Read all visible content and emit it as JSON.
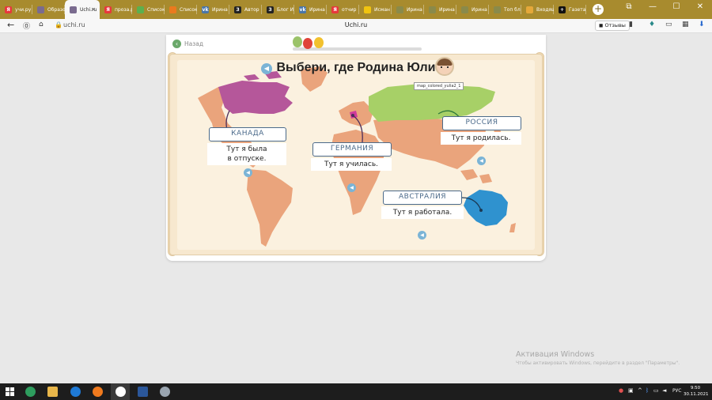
{
  "tabs": [
    {
      "label": "учи.ру",
      "color": "#e7373c",
      "glyph": "Я"
    },
    {
      "label": "Образо",
      "color": "#7a6b8f",
      "glyph": ""
    },
    {
      "label": "Uchi.ru",
      "color": "#7a6b8f",
      "glyph": "",
      "active": true,
      "close": "×"
    },
    {
      "label": "проза.р",
      "color": "#e7373c",
      "glyph": "Я"
    },
    {
      "label": "Список",
      "color": "#5bb04f",
      "glyph": ""
    },
    {
      "label": "Список",
      "color": "#ea7a1e",
      "glyph": ""
    },
    {
      "label": "Ирина",
      "color": "#4a76a8",
      "glyph": "vk"
    },
    {
      "label": "Автор",
      "color": "#222222",
      "glyph": "З"
    },
    {
      "label": "Блог И",
      "color": "#222222",
      "glyph": "З"
    },
    {
      "label": "Ирина",
      "color": "#4a76a8",
      "glyph": "vk"
    },
    {
      "label": "отчир",
      "color": "#e7373c",
      "glyph": "Я"
    },
    {
      "label": "Исман",
      "color": "#f1c40f",
      "glyph": ""
    },
    {
      "label": "Ирина",
      "color": "#8a8a4a",
      "glyph": ""
    },
    {
      "label": "Ирина",
      "color": "#8a8a4a",
      "glyph": ""
    },
    {
      "label": "Ирина",
      "color": "#8a8a4a",
      "glyph": ""
    },
    {
      "label": "Топ бл",
      "color": "#8a8a4a",
      "glyph": ""
    },
    {
      "label": "Входящ",
      "color": "#e5a83a",
      "glyph": ""
    },
    {
      "label": "Газета",
      "color": "#111111",
      "glyph": "+"
    }
  ],
  "newtab": "+",
  "window_controls": [
    "⧉",
    "—",
    "☐",
    "✕"
  ],
  "addressbar": {
    "url": "uchi.ru",
    "page_title": "Uchi.ru",
    "reviews_label": "Отзывы"
  },
  "task": {
    "back_label": "Назад",
    "title": "Выбери, где Родина Юли",
    "tooltip": "map_colored_yulia2_1",
    "labels": {
      "canada": "КАНАДА",
      "germany": "ГЕРМАНИЯ",
      "russia": "РОССИЯ",
      "australia": "АВСТРАЛИЯ"
    },
    "captions": {
      "canada": [
        "Тут я была",
        "в отпуске."
      ],
      "germany": "Тут я училась.",
      "russia": "Тут я родилась.",
      "australia": "Тут я работала."
    }
  },
  "colors": {
    "land": "#eaa47c",
    "canada": "#b5579a",
    "russia": "#a7d067",
    "australia": "#2f92cf",
    "germany": "#cf3a9b",
    "label_border": "#4b6a8a"
  },
  "watermark": {
    "title": "Активация Windows",
    "subtitle": "Чтобы активировать Windows, перейдите в раздел \"Параметры\"."
  },
  "taskbar": {
    "lang": "РУС",
    "time": "9:50",
    "date": "30.11.2021"
  }
}
